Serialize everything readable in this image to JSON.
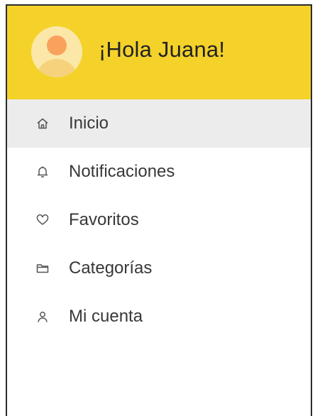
{
  "header": {
    "greeting": "¡Hola Juana!",
    "background_color": "#f4d22a"
  },
  "menu": {
    "active_index": 0,
    "items": [
      {
        "label": "Inicio",
        "icon": "home-icon"
      },
      {
        "label": "Notificaciones",
        "icon": "bell-icon"
      },
      {
        "label": "Favoritos",
        "icon": "heart-icon"
      },
      {
        "label": "Categorías",
        "icon": "folder-icon"
      },
      {
        "label": "Mi cuenta",
        "icon": "user-icon"
      }
    ]
  }
}
